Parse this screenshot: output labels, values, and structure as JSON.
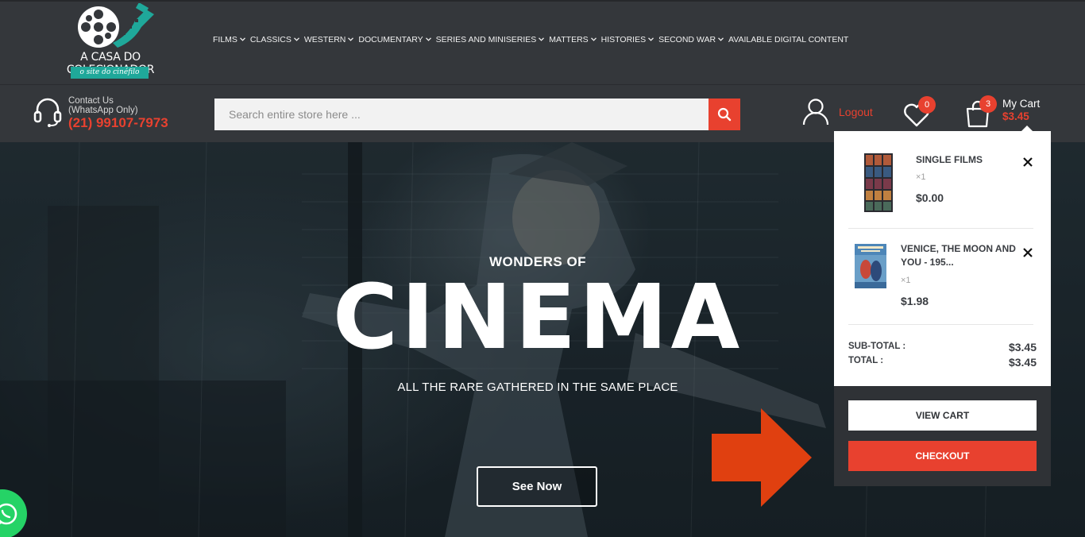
{
  "header": {
    "logo_text": "A CASA DO COLECIONADOR",
    "logo_sub": "o site do cinéfilo",
    "nav": [
      {
        "label": "FILMS",
        "has_dropdown": true
      },
      {
        "label": "CLASSICS",
        "has_dropdown": true
      },
      {
        "label": "WESTERN",
        "has_dropdown": true
      },
      {
        "label": "DOCUMENTARY",
        "has_dropdown": true
      },
      {
        "label": "SERIES AND MINISERIES",
        "has_dropdown": true
      },
      {
        "label": "MATTERS",
        "has_dropdown": true
      },
      {
        "label": "HISTORIES",
        "has_dropdown": true
      },
      {
        "label": "SECOND WAR",
        "has_dropdown": true
      },
      {
        "label": "AVAILABLE DIGITAL CONTENT",
        "has_dropdown": false
      }
    ]
  },
  "contact": {
    "label": "Contact Us",
    "label2": "(WhatsApp Only)",
    "phone": "(21) 99107-7973"
  },
  "search": {
    "placeholder": "Search entire store here ..."
  },
  "account": {
    "logout_label": "Logout"
  },
  "wishlist": {
    "count": "0"
  },
  "cart": {
    "count": "3",
    "label": "My Cart",
    "total": "$3.45",
    "items": [
      {
        "name": "SINGLE FILMS",
        "name2": "",
        "qty": "×1",
        "price": "$0.00"
      },
      {
        "name": "VENICE, THE MOON AND",
        "name2": "YOU - 195...",
        "qty": "×1",
        "price": "$1.98"
      }
    ],
    "subtotal_label": "SUB-TOTAL :",
    "subtotal": "$3.45",
    "total_label": "TOTAL :",
    "grand_total": "$3.45",
    "view_cart_label": "VIEW CART",
    "checkout_label": "CHECKOUT"
  },
  "hero": {
    "kicker": "WONDERS OF",
    "title": "CINEMA",
    "subtitle": "ALL THE RARE GATHERED IN THE SAME PLACE",
    "cta": "See Now"
  },
  "colors": {
    "accent": "#e8412f",
    "header_bg": "#34373b",
    "whatsapp": "#25d366",
    "annotation_arrow": "#e04010"
  }
}
